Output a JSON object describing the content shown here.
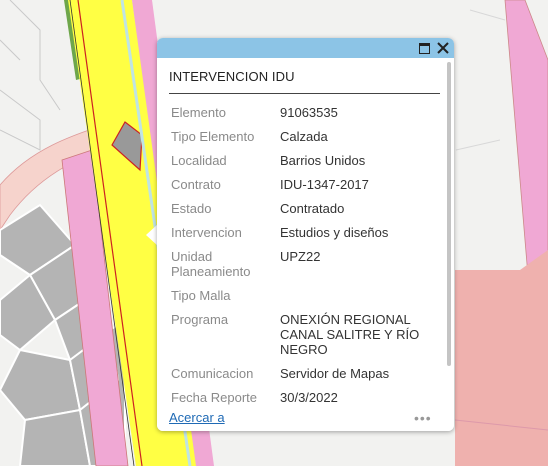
{
  "popup": {
    "title": "INTERVENCION IDU",
    "fields": [
      {
        "key": "Elemento",
        "value": "91063535"
      },
      {
        "key": "Tipo Elemento",
        "value": "Calzada"
      },
      {
        "key": "Localidad",
        "value": "Barrios Unidos"
      },
      {
        "key": "Contrato",
        "value": "IDU-1347-2017"
      },
      {
        "key": "Estado",
        "value": "Contratado"
      },
      {
        "key": "Intervencion",
        "value": "Estudios y diseños"
      },
      {
        "key": "Unidad Planeamiento",
        "value": "UPZ22"
      },
      {
        "key": "Tipo Malla",
        "value": ""
      },
      {
        "key": "Programa",
        "value": "ONEXIÓN REGIONAL CANAL SALITRE Y RÍO NEGRO"
      },
      {
        "key": "Comunicacion",
        "value": "Servidor de Mapas"
      },
      {
        "key": "Fecha Reporte",
        "value": "30/3/2022"
      }
    ],
    "zoom_link": "Acercar a",
    "more_icon": "•••",
    "maximize_icon": "maximize-icon",
    "close_icon": "✕"
  },
  "colors": {
    "header": "#8cc4e6",
    "road_yellow": "#ffff44",
    "zone_pink": "#f0a8d4",
    "zone_salmon": "#efb1ae",
    "building_gray": "#b4b4b4",
    "link": "#1f6ab5"
  }
}
